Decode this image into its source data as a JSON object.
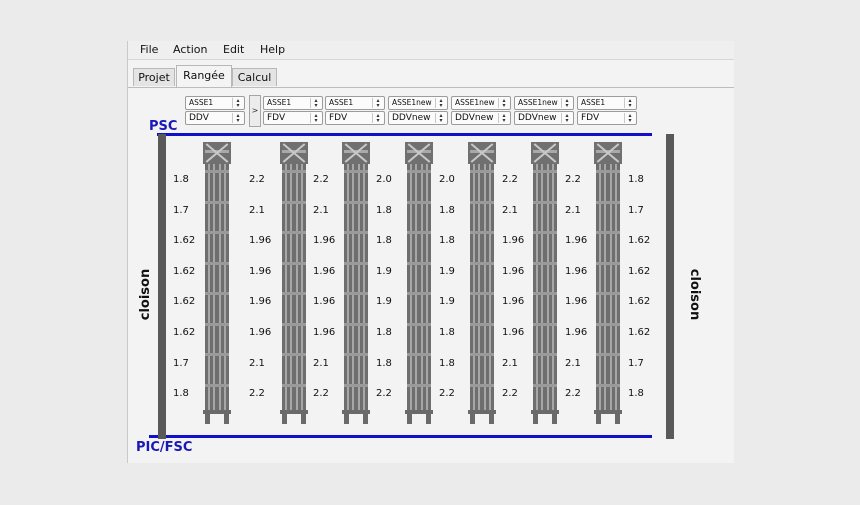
{
  "menu": [
    "File",
    "Action",
    "Edit",
    "Help"
  ],
  "tabs": [
    "Projet",
    "Rangée",
    "Calcul"
  ],
  "active_tab": "Rangée",
  "selectors": [
    {
      "type": "ASSE1",
      "mode": "DDV"
    },
    {
      "type": "ASSE1",
      "mode": "FDV"
    },
    {
      "type": "ASSE1",
      "mode": "FDV"
    },
    {
      "type": "ASSE1new",
      "mode": "DDVnew"
    },
    {
      "type": "ASSE1new",
      "mode": "DDVnew"
    },
    {
      "type": "ASSE1new",
      "mode": "DDVnew"
    },
    {
      "type": "ASSE1",
      "mode": "FDV"
    }
  ],
  "separator_glyph": ">",
  "labels": {
    "top_boundary": "PSC",
    "bottom_boundary": "PIC/FSC",
    "left_wall": "cloison",
    "right_wall": "cloison"
  },
  "value_columns": [
    [
      "1.8",
      "1.7",
      "1.62",
      "1.62",
      "1.62",
      "1.62",
      "1.7",
      "1.8"
    ],
    [
      "2.2",
      "2.1",
      "1.96",
      "1.96",
      "1.96",
      "1.96",
      "2.1",
      "2.2"
    ],
    [
      "2.2",
      "2.1",
      "1.96",
      "1.96",
      "1.96",
      "1.96",
      "2.1",
      "2.2"
    ],
    [
      "2.0",
      "1.8",
      "1.8",
      "1.9",
      "1.9",
      "1.8",
      "1.8",
      "2.2"
    ],
    [
      "2.0",
      "1.8",
      "1.8",
      "1.9",
      "1.9",
      "1.8",
      "1.8",
      "2.2"
    ],
    [
      "2.2",
      "2.1",
      "1.96",
      "1.96",
      "1.96",
      "1.96",
      "2.1",
      "2.2"
    ],
    [
      "2.2",
      "2.1",
      "1.96",
      "1.96",
      "1.96",
      "1.96",
      "2.1",
      "2.2"
    ],
    [
      "1.8",
      "1.7",
      "1.62",
      "1.62",
      "1.62",
      "1.62",
      "1.7",
      "1.8"
    ]
  ],
  "colors": {
    "boundary_line": "#1010c8",
    "wall": "#595959",
    "column": "#6e6e6e"
  }
}
